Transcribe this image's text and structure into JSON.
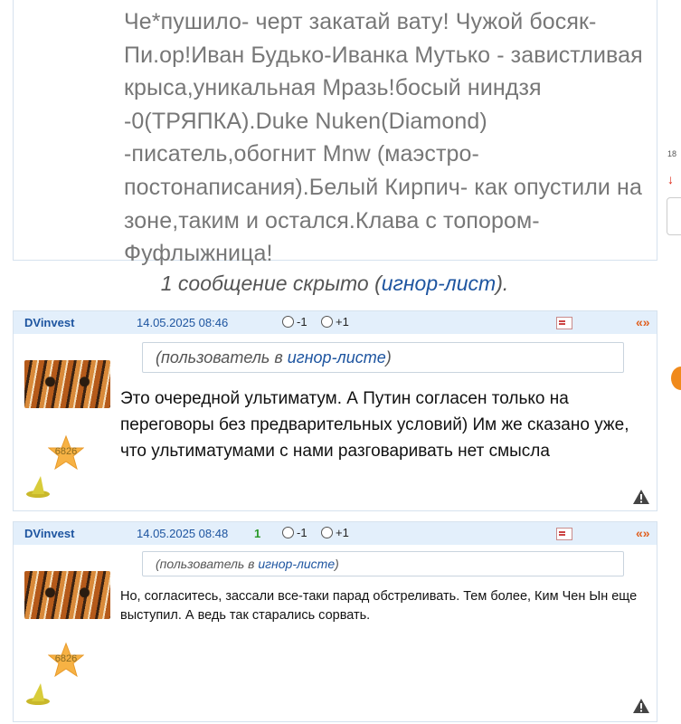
{
  "top_post": {
    "text": "Че*пушило- черт закатай вату! Чужой босяк-Пи.ор!Иван Будько-Иванка Мутько - завистливая крыса,уникальная Мразь!босый ниндзя -0(ТРЯПКА).Duke Nuken(Diamond) -писатель,обогнит Mnw (маэстро-постонаписания).Белый Кирпич- как опустили на зоне,таким и остался.Клава с топором-Фуфлыжница!"
  },
  "right_strip": {
    "number": "18",
    "arrow": "↓"
  },
  "hidden_note": {
    "prefix": "1 сообщение скрыто (",
    "link": "игнор-лист",
    "suffix": ")."
  },
  "posts": [
    {
      "author": "DVinvest",
      "date": "14.05.2025 08:46",
      "score": "",
      "vote_minus": "-1",
      "vote_plus": "+1",
      "nav": "«»",
      "ignore_prefix": "(пользователь в ",
      "ignore_link": "игнор-листе",
      "ignore_suffix": ")",
      "rating": "6826",
      "message": "Это очередной ультиматум. А Путин согласен только на переговоры без предварительных условий) Им же сказано уже, что ультиматумами с нами разговаривать нет смысла"
    },
    {
      "author": "DVinvest",
      "date": "14.05.2025 08:48",
      "score": "1",
      "vote_minus": "-1",
      "vote_plus": "+1",
      "nav": "«»",
      "ignore_prefix": "(пользователь в ",
      "ignore_link": "игнор-листе",
      "ignore_suffix": ")",
      "rating": "6826",
      "message": "Но, согласитесь, зассали все-таки парад обстреливать. Тем более, Ким Чен Ын еще выступил. А ведь так старались сорвать."
    }
  ],
  "colors": {
    "header_bg": "#e3effb",
    "link": "#1e55a0",
    "score": "#2a9a2a",
    "nav": "#e06020"
  }
}
